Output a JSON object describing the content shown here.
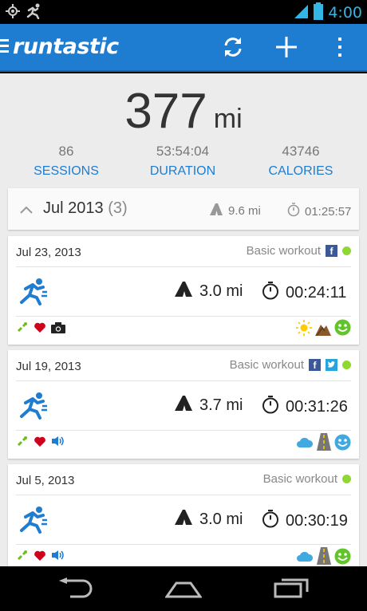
{
  "status": {
    "time": "4:00"
  },
  "app": {
    "brand": "runtastic"
  },
  "summary": {
    "distance": "377",
    "unit": "mi"
  },
  "stats": [
    {
      "value": "86",
      "label": "SESSIONS"
    },
    {
      "value": "53:54:04",
      "label": "DURATION"
    },
    {
      "value": "43746",
      "label": "CALORIES"
    }
  ],
  "month": {
    "title": "Jul 2013",
    "count": "(3)",
    "distance": "9.6 mi",
    "duration": "01:25:57"
  },
  "sessions": [
    {
      "date": "Jul 23, 2013",
      "type": "Basic workout",
      "distance": "3.0 mi",
      "duration": "00:24:11"
    },
    {
      "date": "Jul 19, 2013",
      "type": "Basic workout",
      "distance": "3.7 mi",
      "duration": "00:31:26"
    },
    {
      "date": "Jul 5, 2013",
      "type": "Basic workout",
      "distance": "3.0 mi",
      "duration": "00:30:19"
    }
  ],
  "colors": {
    "accent": "#1e7dd0",
    "status_blue": "#33b5e5",
    "green": "#8ed831"
  }
}
